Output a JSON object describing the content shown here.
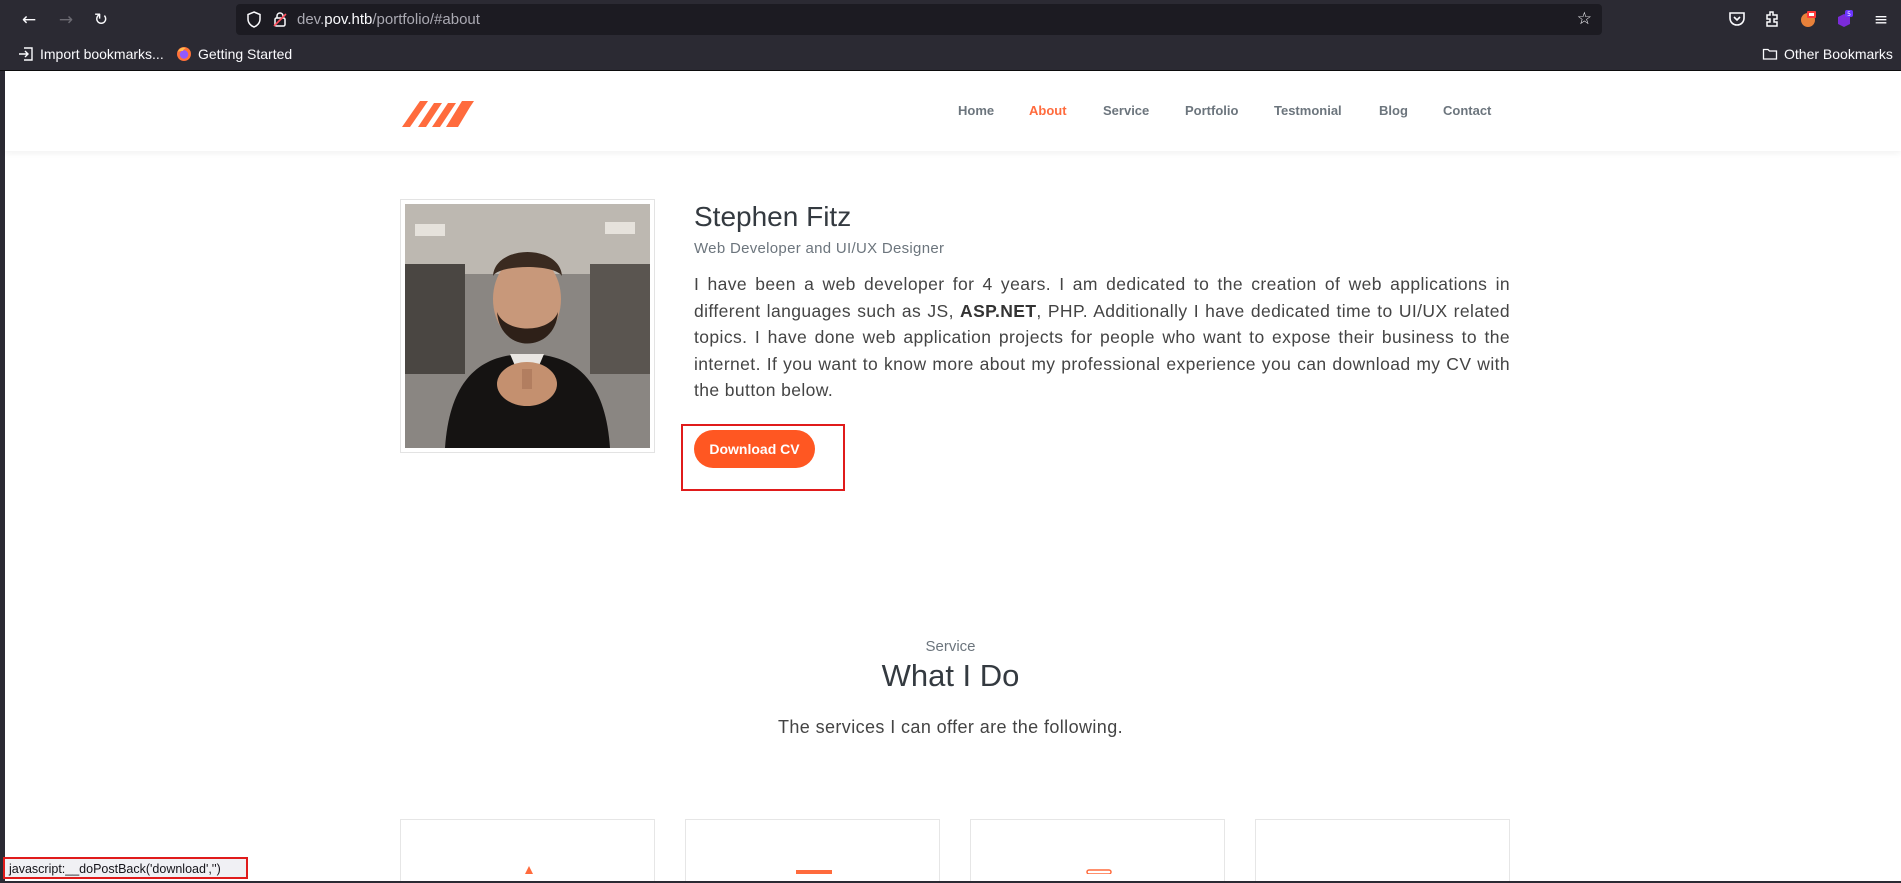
{
  "browser": {
    "url_prefix": "dev.",
    "url_domain": "pov.htb",
    "url_path": "/portfolio/#about",
    "bookmarks": {
      "import": "Import bookmarks...",
      "getting_started": "Getting Started",
      "other": "Other Bookmarks"
    },
    "extension_badge": "5",
    "status_text": "javascript:__doPostBack('download','')"
  },
  "site": {
    "menu": [
      "Home",
      "About",
      "Service",
      "Portfolio",
      "Testmonial",
      "Blog",
      "Contact"
    ],
    "active_menu": "About",
    "accent_color": "#ff6b3d"
  },
  "about": {
    "name": "Stephen Fitz",
    "role": "Web Developer and UI/UX Designer",
    "bio_part1": "I have been a web developer for 4 years. I am dedicated to the creation of web applications in different languages such as JS, ",
    "bio_bold": "ASP.NET",
    "bio_part2": ", PHP. Additionally I have dedicated time to UI/UX related topics. I have done web application projects for people who want to expose their business to the internet. If you want to know more about my professional experience you can download my CV with the button below.",
    "cv_button": "Download CV"
  },
  "services": {
    "label": "Service",
    "title": "What I Do",
    "subtitle": "The services I can offer are the following."
  }
}
